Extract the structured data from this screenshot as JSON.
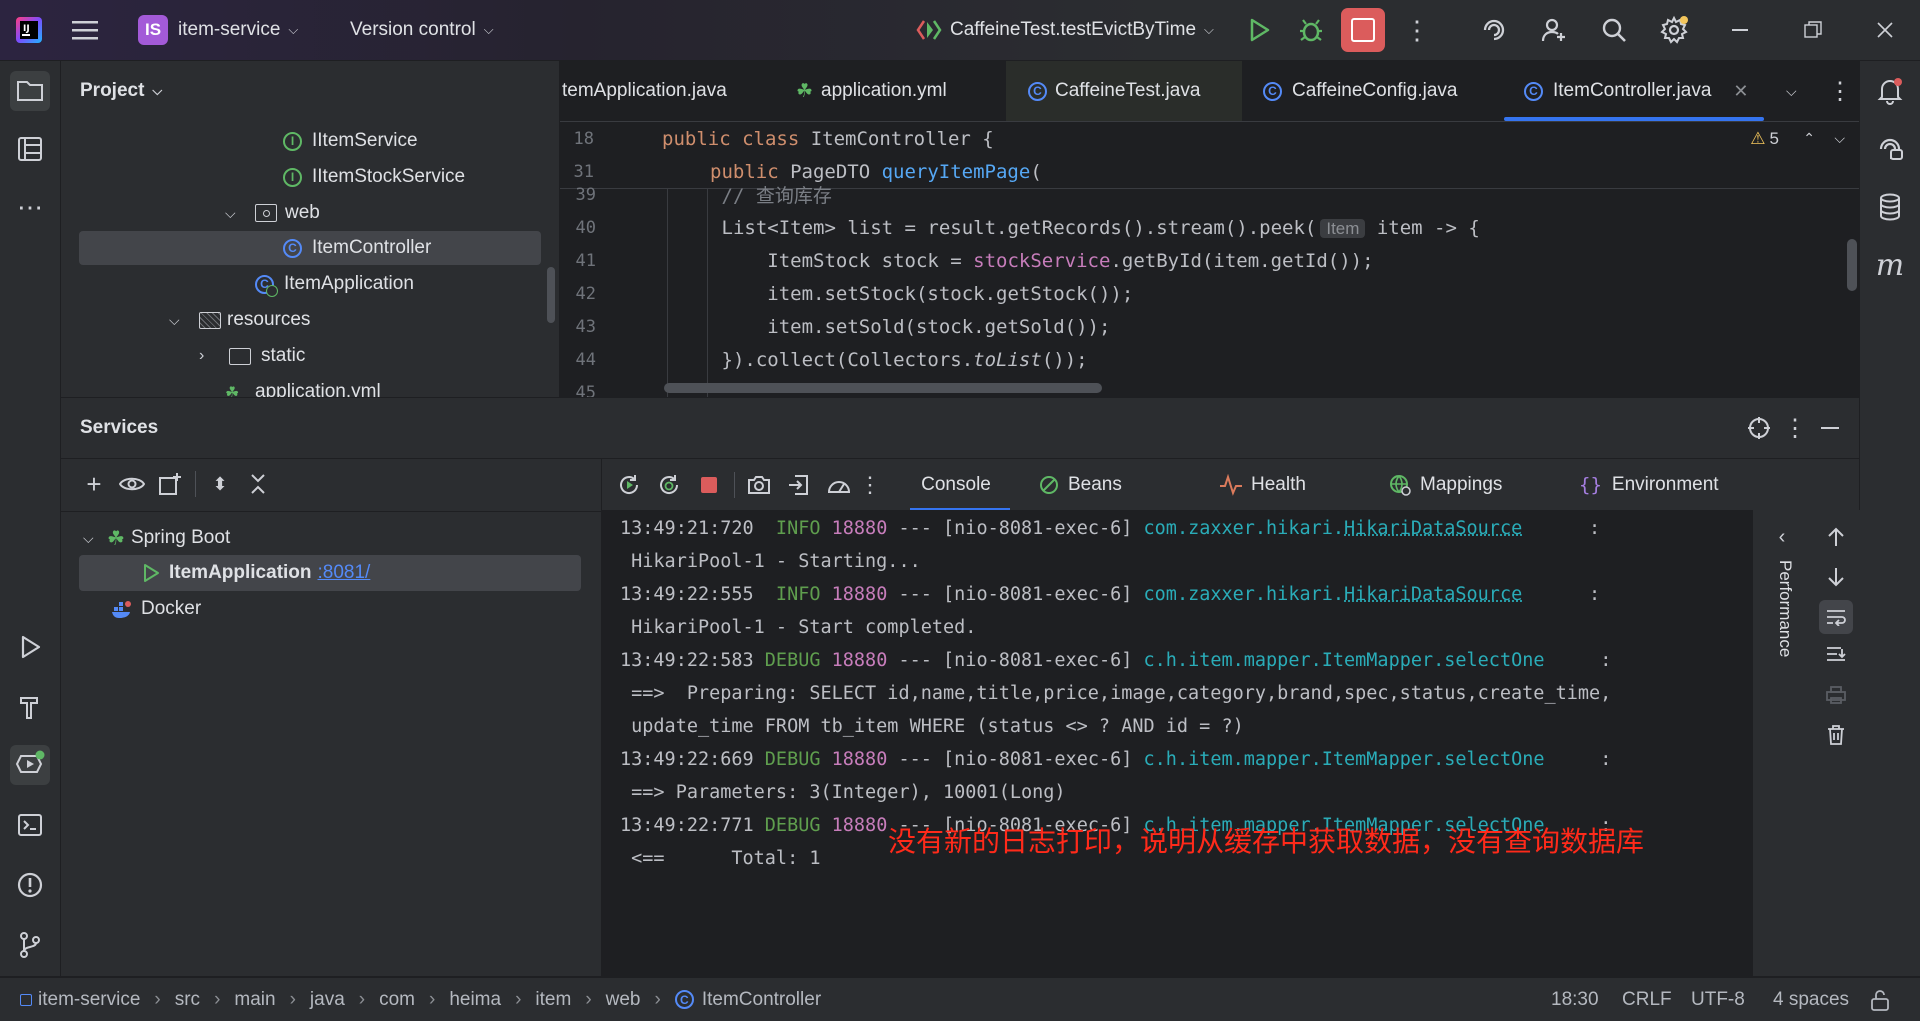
{
  "titlebar": {
    "project_badge": "IS",
    "project_name": "item-service",
    "vcs_label": "Version control",
    "run_config": "CaffeineTest.testEvictByTime"
  },
  "project_panel": {
    "title": "Project",
    "tree": [
      {
        "label": "IItemService",
        "icon": "interface"
      },
      {
        "label": "IItemStockService",
        "icon": "interface"
      },
      {
        "label": "web",
        "icon": "package"
      },
      {
        "label": "ItemController",
        "icon": "class"
      },
      {
        "label": "ItemApplication",
        "icon": "spring-class"
      },
      {
        "label": "resources",
        "icon": "folder"
      },
      {
        "label": "static",
        "icon": "folder"
      },
      {
        "label": "application.yml",
        "icon": "yml"
      }
    ]
  },
  "editor": {
    "tabs": [
      {
        "label": "temApplication.java"
      },
      {
        "label": "application.yml"
      },
      {
        "label": "CaffeineTest.java"
      },
      {
        "label": "CaffeineConfig.java"
      },
      {
        "label": "ItemController.java",
        "active": true
      }
    ],
    "warning_count": "5",
    "sticky": [
      {
        "num": "18",
        "text": "public class ItemController {"
      },
      {
        "num": "31",
        "text": "    public PageDTO queryItemPage("
      }
    ],
    "lines": [
      {
        "num": "39",
        "text": "        // 查询库存"
      },
      {
        "num": "40",
        "pre": "        List<Item> list = result.getRecords().stream().peek(",
        "hint": "Item",
        "post": " item -> {"
      },
      {
        "num": "41",
        "pre": "            ItemStock stock = ",
        "field": "stockService",
        "post": ".getById(item.getId());"
      },
      {
        "num": "42",
        "text": "            item.setStock(stock.getStock());"
      },
      {
        "num": "43",
        "text": "            item.setSold(stock.getSold());"
      },
      {
        "num": "44",
        "pre": "        }).collect(Collectors.",
        "italic": "toList",
        "post": "());"
      },
      {
        "num": "45",
        "text": ""
      }
    ]
  },
  "services": {
    "title": "Services",
    "tree": [
      {
        "label": "Spring Boot"
      },
      {
        "label": "ItemApplication",
        "port": ":8081/"
      },
      {
        "label": "Docker"
      }
    ],
    "console_tabs": [
      "Console",
      "Beans",
      "Health",
      "Mappings",
      "Environment"
    ],
    "side_label": "Performance",
    "log": [
      {
        "time": "13:49:21:720",
        "level": " INFO",
        "pid": "18880",
        "thread": " --- [nio-8081-exec-6] ",
        "logger_pre": "com.zaxxer.hikari.",
        "logger_link": "HikariDataSource",
        "tail": "      :"
      },
      {
        "text": " HikariPool-1 - Starting..."
      },
      {
        "time": "13:49:22:555",
        "level": " INFO",
        "pid": "18880",
        "thread": " --- [nio-8081-exec-6] ",
        "logger_pre": "com.zaxxer.hikari.",
        "logger_link": "HikariDataSource",
        "tail": "      :"
      },
      {
        "text": " HikariPool-1 - Start completed."
      },
      {
        "time": "13:49:22:583",
        "level": "DEBUG",
        "pid": "18880",
        "thread": " --- [nio-8081-exec-6] ",
        "logger_pre": "c.h.item.mapper.ItemMapper.selectOne",
        "logger_link": "",
        "tail": "     :"
      },
      {
        "text": " ==>  Preparing: SELECT id,name,title,price,image,category,brand,spec,status,create_time,"
      },
      {
        "text": " update_time FROM tb_item WHERE (status <> ? AND id = ?)"
      },
      {
        "time": "13:49:22:669",
        "level": "DEBUG",
        "pid": "18880",
        "thread": " --- [nio-8081-exec-6] ",
        "logger_pre": "c.h.item.mapper.ItemMapper.selectOne",
        "logger_link": "",
        "tail": "     :"
      },
      {
        "text": " ==> Parameters: 3(Integer), 10001(Long)"
      },
      {
        "time": "13:49:22:771",
        "level": "DEBUG",
        "pid": "18880",
        "thread": " --- [nio-8081-exec-6] ",
        "logger_pre": "c.h.item.mapper.ItemMapper.selectOne",
        "logger_link": "",
        "tail": "     :"
      },
      {
        "text": " <==      Total: 1"
      }
    ],
    "annotation": "没有新的日志打印，说明从缓存中获取数据，没有查询数据库"
  },
  "statusbar": {
    "breadcrumb": [
      "item-service",
      "src",
      "main",
      "java",
      "com",
      "heima",
      "item",
      "web",
      "ItemController"
    ],
    "position": "18:30",
    "line_sep": "CRLF",
    "encoding": "UTF-8",
    "indent": "4 spaces"
  },
  "colors": {
    "accent": "#3574f0",
    "stop_red": "#db5c5c",
    "run_green": "#5fb865",
    "annotation_red": "#ff2a1a",
    "log_teal": "#2aacb8",
    "log_green": "#5f9e4e"
  }
}
